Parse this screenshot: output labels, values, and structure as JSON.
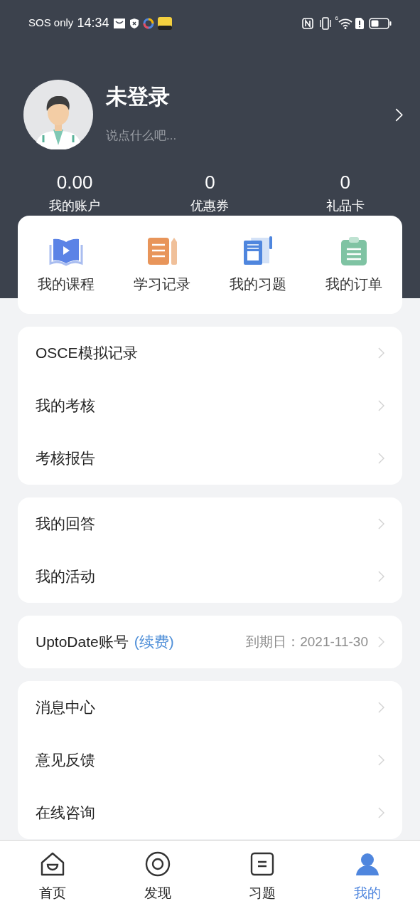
{
  "status_bar": {
    "carrier": "SOS only",
    "time": "14:34",
    "network_label": "6"
  },
  "profile": {
    "name": "未登录",
    "bio": "说点什么吧..."
  },
  "stats": [
    {
      "value": "0.00",
      "label": "我的账户"
    },
    {
      "value": "0",
      "label": "优惠券"
    },
    {
      "value": "0",
      "label": "礼品卡"
    }
  ],
  "shortcuts": [
    {
      "kind": "course",
      "label": "我的课程"
    },
    {
      "kind": "record",
      "label": "学习记录"
    },
    {
      "kind": "exercise",
      "label": "我的习题"
    },
    {
      "kind": "order",
      "label": "我的订单"
    }
  ],
  "menu_groups": [
    {
      "items": [
        {
          "label": "OSCE模拟记录"
        },
        {
          "label": "我的考核"
        },
        {
          "label": "考核报告"
        }
      ]
    },
    {
      "items": [
        {
          "label": "我的回答"
        },
        {
          "label": "我的活动"
        }
      ]
    },
    {
      "items": [
        {
          "label": "UptoDate账号",
          "link": "(续费)",
          "detail": "到期日：2021-11-30"
        }
      ]
    },
    {
      "items": [
        {
          "label": "消息中心"
        },
        {
          "label": "意见反馈"
        },
        {
          "label": "在线咨询"
        }
      ]
    }
  ],
  "tab_bar": [
    {
      "kind": "home",
      "label": "首页",
      "selected": false
    },
    {
      "kind": "discover",
      "label": "发现",
      "selected": false
    },
    {
      "kind": "exercise",
      "label": "习题",
      "selected": false
    },
    {
      "kind": "me",
      "label": "我的",
      "selected": true
    }
  ]
}
